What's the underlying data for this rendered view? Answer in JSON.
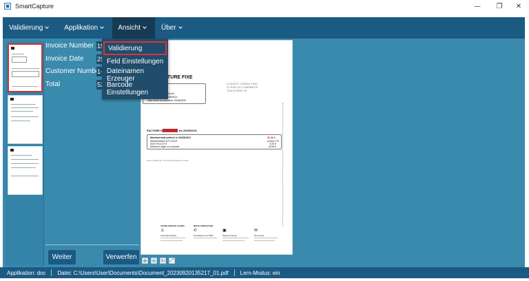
{
  "window": {
    "title": "SmartCapture",
    "controls": {
      "minimize": "—",
      "maximize": "❐",
      "close": "✕"
    }
  },
  "menubar": {
    "items": [
      {
        "label": "Validierung"
      },
      {
        "label": "Applikation"
      },
      {
        "label": "Ansicht"
      },
      {
        "label": "Über"
      }
    ],
    "active": "Ansicht"
  },
  "dropdown": {
    "items": [
      {
        "label": "Validierung"
      },
      {
        "label": "Feld Einstellungen"
      },
      {
        "label": "Dateinamen Erzeuger"
      },
      {
        "label": "Barcode Einstellungen"
      }
    ],
    "highlighted": "Validierung"
  },
  "fields": [
    {
      "label": "Invoice Number",
      "value": "15"
    },
    {
      "label": "Invoice Date",
      "value": "25"
    },
    {
      "label": "Customer Number",
      "value": "1-"
    },
    {
      "label": "Total",
      "value": "52"
    }
  ],
  "buttons": {
    "next": "Weiter",
    "discard": "Verwerfen"
  },
  "document": {
    "heading": "FACTURE FIXE",
    "sender_block": [
      "N OUEST CONSULTING",
      "21 RUE DU COMMERCE",
      "75015 PARIS 15"
    ],
    "client_lines": [
      "100001004XXX",
      "01 23 45 67 89",
      "pierre.martin@gmail.com",
      "Date de facture: 25/05/2022",
      "Date limite de paiement: 29/06/2022"
    ],
    "invoice_label": "FACTURE N°",
    "invoice_suffix": "du 25/05/2021",
    "summary_title": "Montant total prélevé le 04/05/2021",
    "summary_lines": [
      "Montant facturé (HT) 43,8 €",
      "Dont TVA à 20 %",
      "Montant à régler ou à reporter"
    ],
    "summary_amounts": [
      "52,56 €",
      "au taux TTC",
      "8,76 €",
      "52,56 €"
    ],
    "note": "Les montants en TTC sont exprimés en euros",
    "footer_headings": [
      "VOTRE ESPACE CLIENT",
      "NOUS CONTACTER"
    ],
    "footer_items": [
      "Accessible 24h/24",
      "Par téléphone au 3900",
      "Depuis l'étranger",
      "Par courrier"
    ]
  },
  "statusbar": {
    "application": "Applikation: doc",
    "file": "Datei: C:\\Users\\User\\Documents\\Document_20230920135217_01.pdf",
    "learn_mode": "Lern-Modus: ein"
  },
  "colors": {
    "menubar": "#1b5a82",
    "panel": "#3a8aad",
    "highlight": "#e0303a"
  }
}
